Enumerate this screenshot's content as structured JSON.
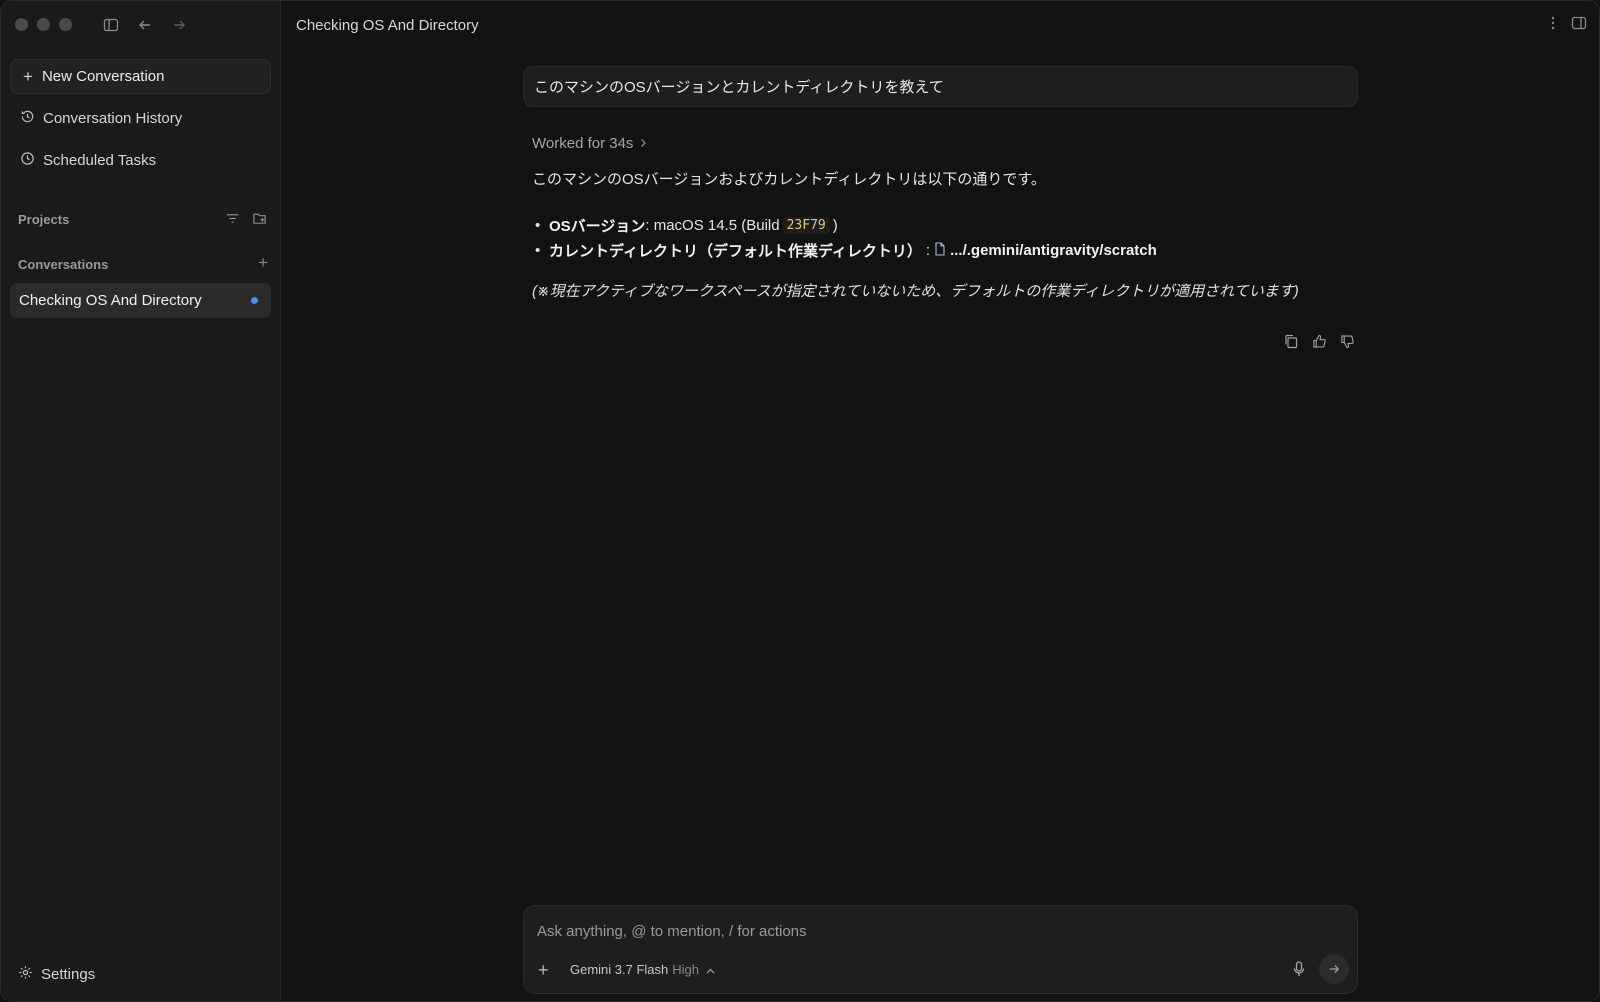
{
  "sidebar": {
    "new_conversation": "New Conversation",
    "nav": [
      {
        "label": "Conversation History",
        "icon": "history-icon"
      },
      {
        "label": "Scheduled Tasks",
        "icon": "clock-icon"
      }
    ],
    "projects_label": "Projects",
    "conversations_label": "Conversations",
    "conversations": [
      {
        "title": "Checking OS And Directory",
        "active": true,
        "unread": true
      }
    ],
    "settings_label": "Settings"
  },
  "main": {
    "title": "Checking OS And Directory",
    "user_message": "このマシンのOSバージョンとカレントディレクトリを教えて",
    "worked_label": "Worked for 34s",
    "answer": {
      "intro": "このマシンのOSバージョンおよびカレントディレクトリは以下の通りです。",
      "os_label": "OSバージョン",
      "os_value_prefix": ": macOS 14.5 (Build",
      "build_code": "23F79",
      "os_value_suffix": ")",
      "cwd_label": "カレントディレクトリ（デフォルト作業ディレクトリ）",
      "cwd_sep": ":",
      "cwd_path": ".../.gemini/antigravity/scratch",
      "note": "(※現在アクティブなワークスペースが指定されていないため、デフォルトの作業ディレクトリが適用されています)"
    }
  },
  "composer": {
    "placeholder": "Ask anything, @ to mention, / for actions",
    "model_name": "Gemini 3.7 Flash",
    "model_level": "High"
  },
  "colors": {
    "background": "#121212",
    "sidebar": "#1a1a1a",
    "accent_dot": "#4f8bf0",
    "code_text": "#e3c58a"
  }
}
